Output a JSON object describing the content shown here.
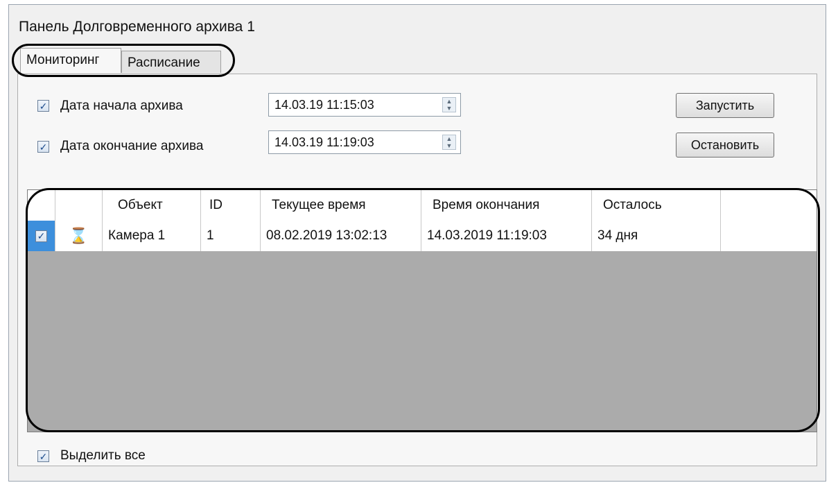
{
  "window": {
    "title": "Панель Долговременного архива 1"
  },
  "tabs": [
    {
      "label": "Мониторинг",
      "active": true
    },
    {
      "label": "Расписание",
      "active": false
    }
  ],
  "form": {
    "start": {
      "checked": true,
      "label": "Дата начала архива",
      "value": "14.03.19 11:15:03"
    },
    "end": {
      "checked": true,
      "label": "Дата окончание архива",
      "value": "14.03.19 11:19:03"
    },
    "start_button": "Запустить",
    "stop_button": "Остановить"
  },
  "table": {
    "columns": [
      "",
      "",
      "Объект",
      "ID",
      "Текущее время",
      "Время окончания",
      "Осталось",
      ""
    ],
    "rows": [
      {
        "checked": true,
        "icon": "hourglass-icon",
        "object": "Камера 1",
        "id": "1",
        "current_time": "08.02.2019 13:02:13",
        "end_time": "14.03.2019 11:19:03",
        "remaining": "34 дня"
      }
    ]
  },
  "footer": {
    "select_all_checked": true,
    "select_all_label": "Выделить все"
  },
  "colors": {
    "window_bg": "#f0f0f0",
    "grid_empty_bg": "#ababab",
    "highlight": "#000000"
  }
}
